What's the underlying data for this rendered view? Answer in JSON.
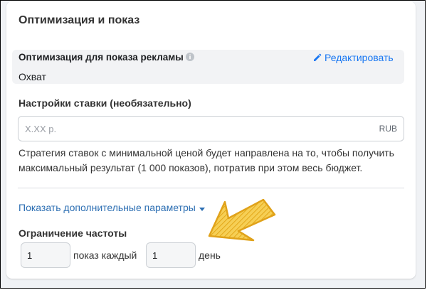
{
  "section": {
    "title": "Оптимизация и показ"
  },
  "optimization": {
    "label": "Оптимизация для показа рекламы",
    "info_icon": "info-icon",
    "edit_label": "Редактировать",
    "edit_icon": "pencil-icon",
    "value": "Охват"
  },
  "bid": {
    "label": "Настройки ставки (необязательно)",
    "placeholder": "X.XX р.",
    "value": "",
    "currency": "RUB",
    "description": "Стратегия ставок с минимальной ценой будет направлена на то, чтобы получить максимальный результат (1 000 показов), потратив при этом весь бюджет."
  },
  "advanced": {
    "toggle_label": "Показать дополнительные параметры",
    "toggle_icon": "caret-down-icon"
  },
  "frequency": {
    "label": "Ограничение частоты",
    "impressions_value": "1",
    "middle_text": "показ каждый",
    "days_value": "1",
    "end_text": "день"
  },
  "colors": {
    "link": "#1877f2",
    "annotation_arrow": "#e8b020"
  }
}
